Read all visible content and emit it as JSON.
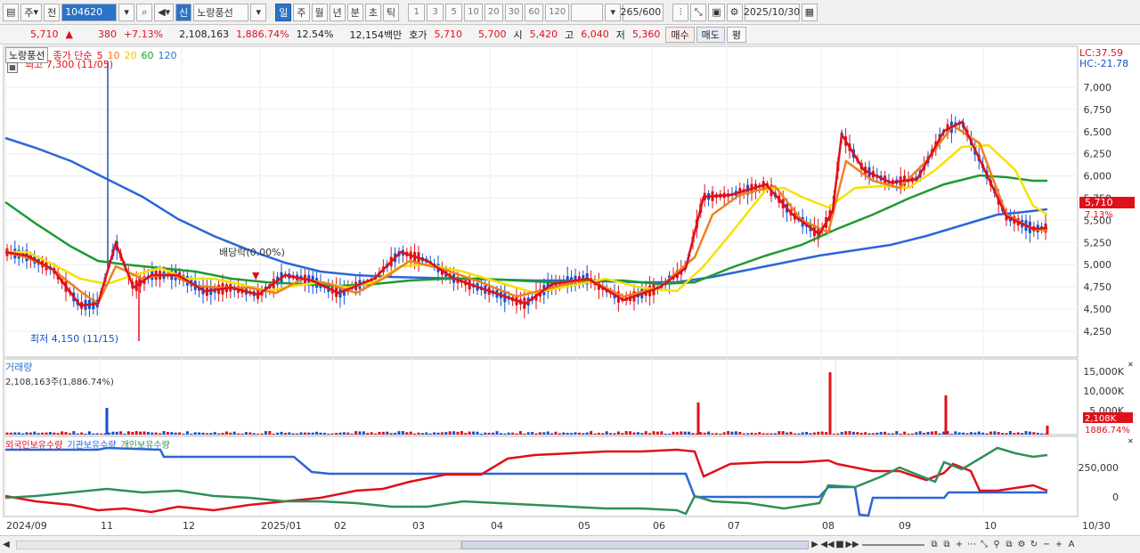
{
  "toolbar": {
    "market_label": "주",
    "jeon_label": "전",
    "stock_code": "104620",
    "credit_badge": "신",
    "stock_name": "노랑풍선",
    "periods": [
      "일",
      "주",
      "월",
      "년",
      "분",
      "초",
      "틱"
    ],
    "selected_period": "일",
    "intervals": [
      "1",
      "3",
      "5",
      "10",
      "20",
      "30",
      "60",
      "120"
    ],
    "count": "265",
    "count_total": "/600",
    "date": "2025/10/30"
  },
  "quote": {
    "price": "5,710",
    "change": "380",
    "change_pct": "+7.13%",
    "volume": "2,108,163",
    "volume_pct": "1,886.74%",
    "turnover": "12.54%",
    "amount": "12,154백만",
    "bid_label": "호가",
    "ask": "5,710",
    "bid": "5,700",
    "open_label": "시",
    "open": "5,420",
    "high_label": "고",
    "high": "6,040",
    "low_label": "저",
    "low": "5,360",
    "buy_button": "매수",
    "sell_button": "매도",
    "avg_button": "평"
  },
  "price_panel": {
    "stock_name": "노랑풍선",
    "ma_label": "종가 단순",
    "ma_periods": [
      {
        "period": "5",
        "color": "#e0101a"
      },
      {
        "period": "10",
        "color": "#f08020"
      },
      {
        "period": "20",
        "color": "#e8d000"
      },
      {
        "period": "60",
        "color": "#1e9a30"
      },
      {
        "period": "120",
        "color": "#2a73c8"
      }
    ],
    "high_marker": "최고 7,300 (11/05)",
    "low_marker": "최저 4,150 (11/15)",
    "dividend_marker": "배당락(0.00%)",
    "lc": "LC:37.59",
    "hc": "HC:-21.78",
    "current_price_tag": "5,710",
    "current_pct_tag": "7.13%",
    "y_ticks": [
      "7,000",
      "6,750",
      "6,500",
      "6,250",
      "6,000",
      "5,750",
      "5,500",
      "5,250",
      "5,000",
      "4,750",
      "4,500",
      "4,250"
    ]
  },
  "volume_panel": {
    "title": "거래량",
    "value": "2,108,163주(1,886.74%)",
    "y_ticks": [
      "15,000K",
      "10,000K",
      "5,000K"
    ],
    "current_tag": "2,108K",
    "current_pct": "1886.74%"
  },
  "holdings_panel": {
    "series": [
      {
        "name": "외국인보유수량",
        "color": "#e0101a"
      },
      {
        "name": "기관보유수량",
        "color": "#2a66d8"
      },
      {
        "name": "개인보유수량",
        "color": "#2f8f5a"
      }
    ],
    "y_ticks": [
      "250,000",
      "0"
    ]
  },
  "x_axis": [
    "2024/09",
    "11",
    "12",
    "2025/01",
    "02",
    "03",
    "04",
    "05",
    "06",
    "07",
    "08",
    "09",
    "10",
    "10/30"
  ],
  "colors": {
    "up": "#e0101a",
    "down": "#1350d0",
    "accent": "#2a73c8"
  }
}
